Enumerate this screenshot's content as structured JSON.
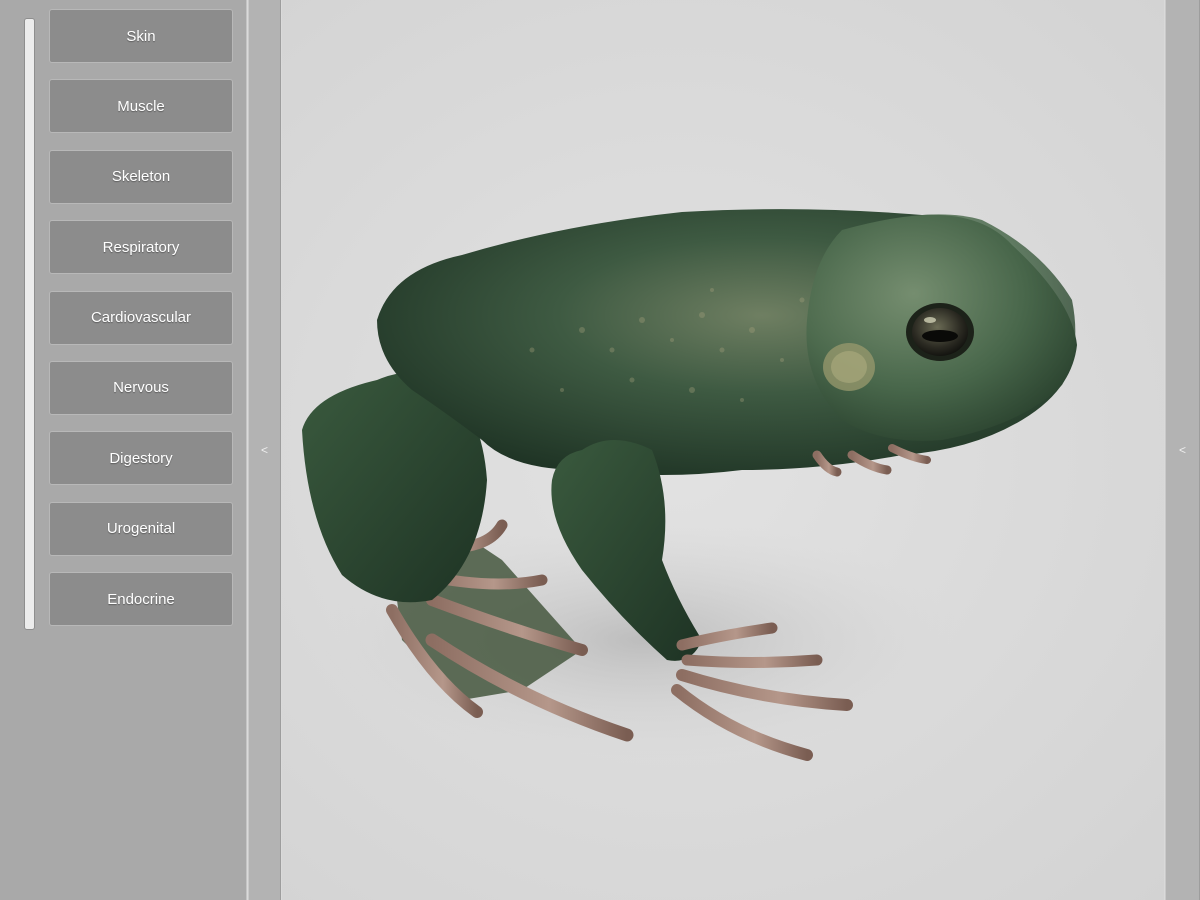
{
  "sidebar": {
    "items": [
      {
        "label": "Skin"
      },
      {
        "label": "Muscle"
      },
      {
        "label": "Skeleton"
      },
      {
        "label": "Respiratory"
      },
      {
        "label": "Cardiovascular"
      },
      {
        "label": "Nervous"
      },
      {
        "label": "Digestory"
      },
      {
        "label": "Urogenital"
      },
      {
        "label": "Endocrine"
      }
    ]
  },
  "panel_toggles": {
    "left_glyph": "<",
    "right_glyph": "<"
  },
  "viewport": {
    "model": "frog-3d-model",
    "colors": {
      "skin_dark": "#233a2a",
      "skin_mid": "#3e5a42",
      "skin_light": "#6f8a6a",
      "toes": "#a98a7d",
      "background": "#dadada"
    }
  }
}
